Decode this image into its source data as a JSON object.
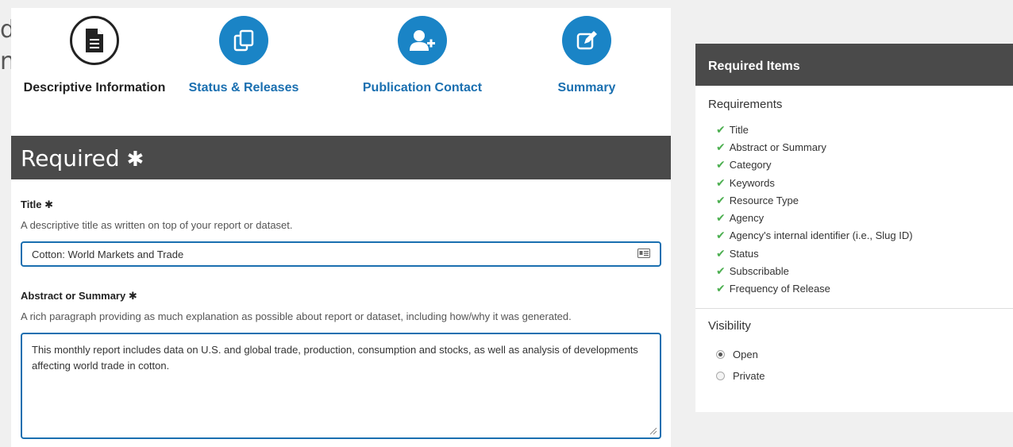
{
  "background_text": {
    "line1": "d",
    "line2": "n"
  },
  "steps": [
    {
      "label": "Descriptive Information",
      "icon": "document-icon",
      "state": "done"
    },
    {
      "label": "Status & Releases",
      "icon": "copy-icon",
      "state": "todo"
    },
    {
      "label": "Publication Contact",
      "icon": "add-user-icon",
      "state": "todo"
    },
    {
      "label": "Summary",
      "icon": "edit-icon",
      "state": "todo"
    }
  ],
  "section": {
    "title": "Required",
    "star": "✱"
  },
  "fields": {
    "title": {
      "label": "Title",
      "star": "✱",
      "help": "A descriptive title as written on top of your report or dataset.",
      "value": "Cotton: World Markets and Trade"
    },
    "abstract": {
      "label": "Abstract or Summary",
      "star": "✱",
      "help": "A rich paragraph providing as much explanation as possible about report or dataset, including how/why it was generated.",
      "value": "This monthly report includes data on U.S. and global trade, production, consumption and stocks, as well as analysis of developments affecting world trade in cotton."
    }
  },
  "sidebar": {
    "header": "Required Items",
    "requirements_title": "Requirements",
    "check": "✔",
    "items": [
      "Title",
      "Abstract or Summary",
      "Category",
      "Keywords",
      "Resource Type",
      "Agency",
      "Agency's internal identifier (i.e., Slug ID)",
      "Status",
      "Subscribable",
      "Frequency of Release"
    ],
    "visibility_title": "Visibility",
    "visibility_options": [
      {
        "label": "Open",
        "selected": true
      },
      {
        "label": "Private",
        "selected": false
      }
    ]
  },
  "colors": {
    "accent": "#1a84c6",
    "header": "#4a4a4a",
    "check": "#4caf50"
  }
}
